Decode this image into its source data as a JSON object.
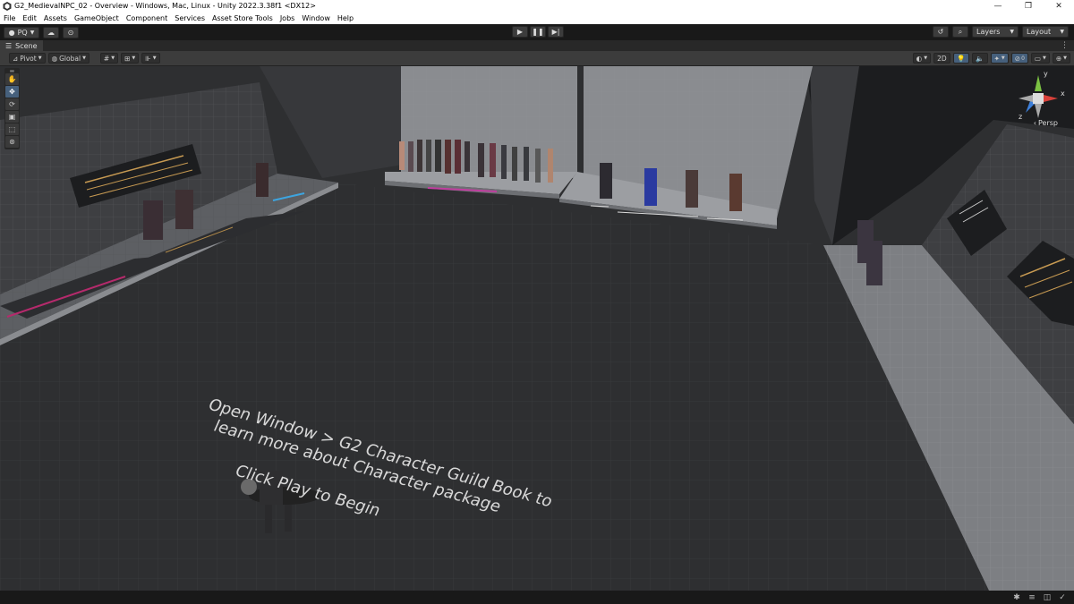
{
  "window": {
    "title": "G2_MedievalNPC_02 - Overview - Windows, Mac, Linux - Unity 2022.3.38f1 <DX12>",
    "controls": [
      "—",
      "❐",
      "✕"
    ]
  },
  "menu": [
    "File",
    "Edit",
    "Assets",
    "GameObject",
    "Component",
    "Services",
    "Asset Store Tools",
    "Jobs",
    "Window",
    "Help"
  ],
  "toolbar": {
    "account_label": "PQ",
    "layers_label": "Layers",
    "layout_label": "Layout"
  },
  "scene_tab": {
    "label": "Scene"
  },
  "scene_toolbar": {
    "pivot_label": "Pivot",
    "global_label": "Global",
    "mode_2d_label": "2D"
  },
  "gizmo": {
    "x_label": "x",
    "y_label": "y",
    "z_label": "z",
    "projection_label": "Persp"
  },
  "viewport_text": {
    "line1": "Open Window > G2 Character Guild Book to",
    "line2": "learn more about Character package",
    "line3": "Click Play to Begin"
  },
  "colors": {
    "accent": "#46607c",
    "floor": "#2e2f31",
    "wall": "#4a4b4e",
    "platform": "#7d7f83"
  }
}
